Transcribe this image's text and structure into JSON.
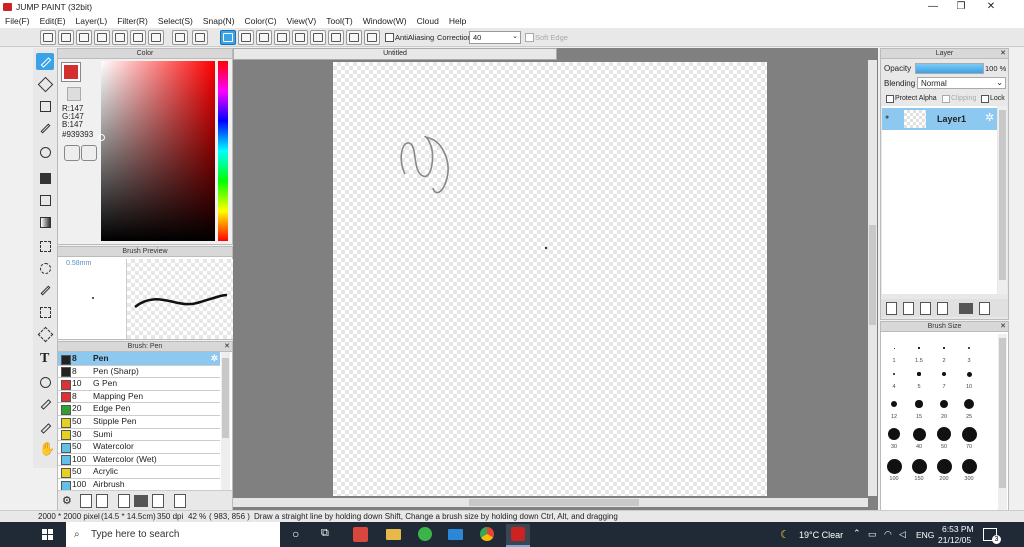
{
  "window": {
    "title": "JUMP PAINT (32bit)",
    "min": "—",
    "max": "❐",
    "close": "✕"
  },
  "menu": [
    "File(F)",
    "Edit(E)",
    "Layer(L)",
    "Filter(R)",
    "Select(S)",
    "Snap(N)",
    "Color(C)",
    "View(V)",
    "Tool(T)",
    "Window(W)",
    "Cloud",
    "Help"
  ],
  "toolbar": {
    "antialiasing": "AntiAliasing",
    "correction_label": "Correction",
    "correction_value": "40",
    "soft_edge": "Soft Edge"
  },
  "color_panel": {
    "title": "Color",
    "r": "R:147",
    "g": "G:147",
    "b": "B:147",
    "hex": "#939393",
    "current": "#d32f2f"
  },
  "brush_preview": {
    "title": "Brush Preview",
    "size": "0.58mm"
  },
  "brush_panel": {
    "title": "Brush: Pen",
    "items": [
      {
        "size": "8",
        "name": "Pen",
        "color": "#222222",
        "selected": true
      },
      {
        "size": "8",
        "name": "Pen (Sharp)",
        "color": "#222222"
      },
      {
        "size": "10",
        "name": "G Pen",
        "color": "#e03030"
      },
      {
        "size": "8",
        "name": "Mapping Pen",
        "color": "#e03030"
      },
      {
        "size": "20",
        "name": "Edge Pen",
        "color": "#30a030"
      },
      {
        "size": "50",
        "name": "Stipple Pen",
        "color": "#e8d020"
      },
      {
        "size": "30",
        "name": "Sumi",
        "color": "#e8d020"
      },
      {
        "size": "50",
        "name": "Watercolor",
        "color": "#60c0e8"
      },
      {
        "size": "100",
        "name": "Watercolor (Wet)",
        "color": "#60c0e8"
      },
      {
        "size": "50",
        "name": "Acrylic",
        "color": "#e8d020"
      },
      {
        "size": "100",
        "name": "Airbrush",
        "color": "#60c0e8"
      }
    ]
  },
  "document": {
    "tab": "Untitled"
  },
  "layer_panel": {
    "title": "Layer",
    "opacity_label": "Opacity",
    "opacity_value": "100 %",
    "opacity": 1.0,
    "blending_label": "Blending",
    "blending_value": "Normal",
    "protect_alpha": "Protect Alpha",
    "clipping": "Clipping",
    "lock": "Lock",
    "layers": [
      {
        "name": "Layer1"
      }
    ]
  },
  "brush_size_panel": {
    "title": "Brush Size",
    "sizes": [
      "1",
      "1.5",
      "2",
      "3",
      "4",
      "5",
      "7",
      "10",
      "12",
      "15",
      "20",
      "25",
      "30",
      "40",
      "50",
      "70",
      "100",
      "150",
      "200",
      "300"
    ]
  },
  "status": {
    "dimensions": "2000 * 2000 pixel",
    "physical": "(14.5 * 14.5cm)",
    "dpi": "350 dpi",
    "zoom": "42 %",
    "coords": "( 983, 856 )",
    "hint": "Draw a straight line by holding down Shift, Change a brush size by holding down Ctrl, Alt, and dragging"
  },
  "taskbar": {
    "search": "Type here to search",
    "weather": "19°C  Clear",
    "lang": "ENG",
    "time": "6:53 PM",
    "date": "21/12/05",
    "notif": "3"
  }
}
